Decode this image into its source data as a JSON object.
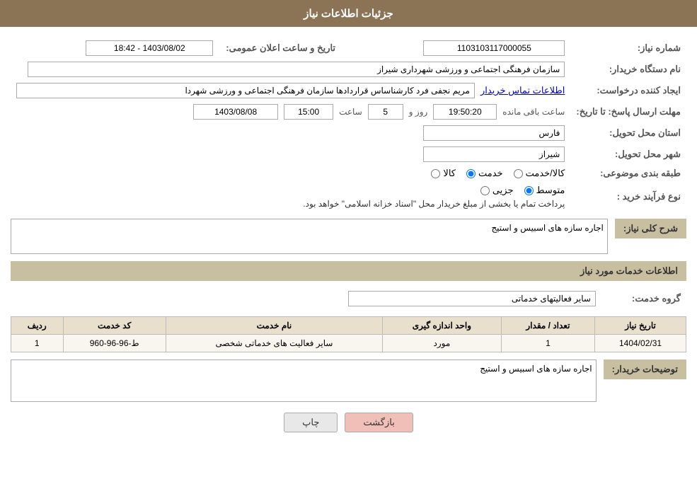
{
  "header": {
    "title": "جزئیات اطلاعات نیاز"
  },
  "fields": {
    "need_number_label": "شماره نیاز:",
    "need_number_value": "1103103117000055",
    "org_name_label": "نام دستگاه خریدار:",
    "org_name_value": "سازمان فرهنگی اجتماعی و ورزشی شهرداری شیراز",
    "announce_date_label": "تاریخ و ساعت اعلان عمومی:",
    "announce_date_value": "1403/08/02 - 18:42",
    "creator_label": "ایجاد کننده درخواست:",
    "creator_name": "مریم نجفی فرد کارشناساس قراردادها سازمان فرهنگی اجتماعی و ورزشی شهردا",
    "creator_link": "اطلاعات تماس خریدار",
    "response_deadline_label": "مهلت ارسال پاسخ: تا تاریخ:",
    "response_date": "1403/08/08",
    "response_time_label": "ساعت",
    "response_time": "15:00",
    "response_day_label": "روز و",
    "response_days": "5",
    "response_remaining_label": "ساعت باقی مانده",
    "response_remaining": "19:50:20",
    "province_label": "استان محل تحویل:",
    "province_value": "فارس",
    "city_label": "شهر محل تحویل:",
    "city_value": "شیراز",
    "category_label": "طبقه بندی موضوعی:",
    "category_options": [
      "کالا",
      "خدمت",
      "کالا/خدمت"
    ],
    "category_selected": "خدمت",
    "purchase_type_label": "نوع فرآیند خرید :",
    "purchase_options": [
      "جزیی",
      "متوسط"
    ],
    "purchase_selected": "متوسط",
    "purchase_note": "پرداخت تمام یا بخشی از مبلغ خریدار محل \"اسناد خزانه اسلامی\" خواهد بود.",
    "description_label": "شرح کلی نیاز:",
    "description_value": "اجاره سازه های اسبیس و استیج",
    "services_section": "اطلاعات خدمات مورد نیاز",
    "service_group_label": "گروه خدمت:",
    "service_group_value": "سایر فعالیتهای خدماتی",
    "table": {
      "columns": [
        "ردیف",
        "کد خدمت",
        "نام خدمت",
        "واحد اندازه گیری",
        "تعداد / مقدار",
        "تاریخ نیاز"
      ],
      "rows": [
        {
          "row": "1",
          "code": "ط-96-96-960",
          "name": "سایر فعالیت های خدماتی شخصی",
          "unit": "مورد",
          "qty": "1",
          "date": "1404/02/31"
        }
      ]
    },
    "buyer_desc_label": "توضیحات خریدار:",
    "buyer_desc_value": "اجاره سازه های اسبیس و استیج"
  },
  "buttons": {
    "print_label": "چاپ",
    "back_label": "بازگشت"
  }
}
